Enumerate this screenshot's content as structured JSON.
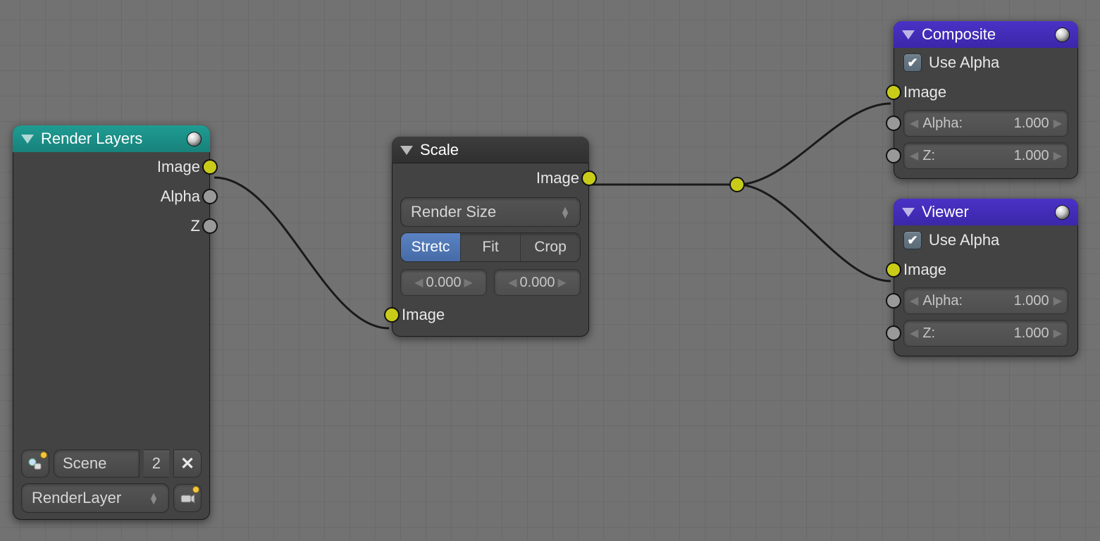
{
  "renderLayers": {
    "title": "Render Layers",
    "outputs": {
      "image": "Image",
      "alpha": "Alpha",
      "z": "Z"
    },
    "scene": {
      "name": "Scene",
      "count": "2"
    },
    "layer": {
      "name": "RenderLayer"
    }
  },
  "scale": {
    "title": "Scale",
    "out": "Image",
    "mode": "Render Size",
    "options": {
      "stretch": "Stretc",
      "fit": "Fit",
      "crop": "Crop"
    },
    "valA": "0.000",
    "valB": "0.000",
    "in": "Image"
  },
  "composite": {
    "title": "Composite",
    "useAlpha": "Use Alpha",
    "image": "Image",
    "alpha": {
      "label": "Alpha:",
      "value": "1.000"
    },
    "z": {
      "label": "Z:",
      "value": "1.000"
    }
  },
  "viewer": {
    "title": "Viewer",
    "useAlpha": "Use Alpha",
    "image": "Image",
    "alpha": {
      "label": "Alpha:",
      "value": "1.000"
    },
    "z": {
      "label": "Z:",
      "value": "1.000"
    }
  }
}
